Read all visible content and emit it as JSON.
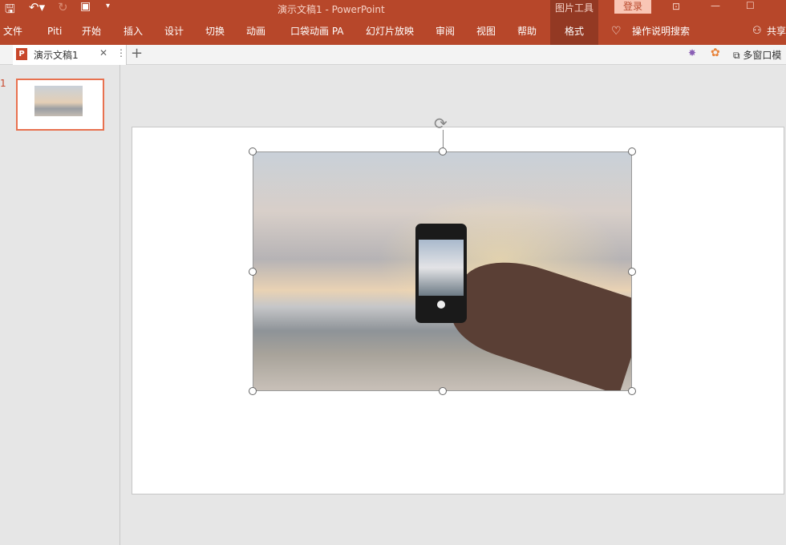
{
  "titlebar": {
    "title": "演示文稿1  -  PowerPoint",
    "context_tool": "图片工具",
    "login": "登录"
  },
  "ribbon": {
    "tabs": [
      "文件",
      "Piti",
      "开始",
      "插入",
      "设计",
      "切换",
      "动画",
      "口袋动画 PA",
      "幻灯片放映",
      "审阅",
      "视图",
      "帮助",
      "格式"
    ],
    "active_tab": "格式",
    "search": "操作说明搜索",
    "share": "共享"
  },
  "doctabs": {
    "current": "演示文稿1",
    "multiwindow": "多窗口模"
  },
  "slides": {
    "number": "1"
  },
  "colors": {
    "accent": "#b7472a",
    "active_tab": "#933923",
    "thumbnail_border": "#e8714f"
  }
}
